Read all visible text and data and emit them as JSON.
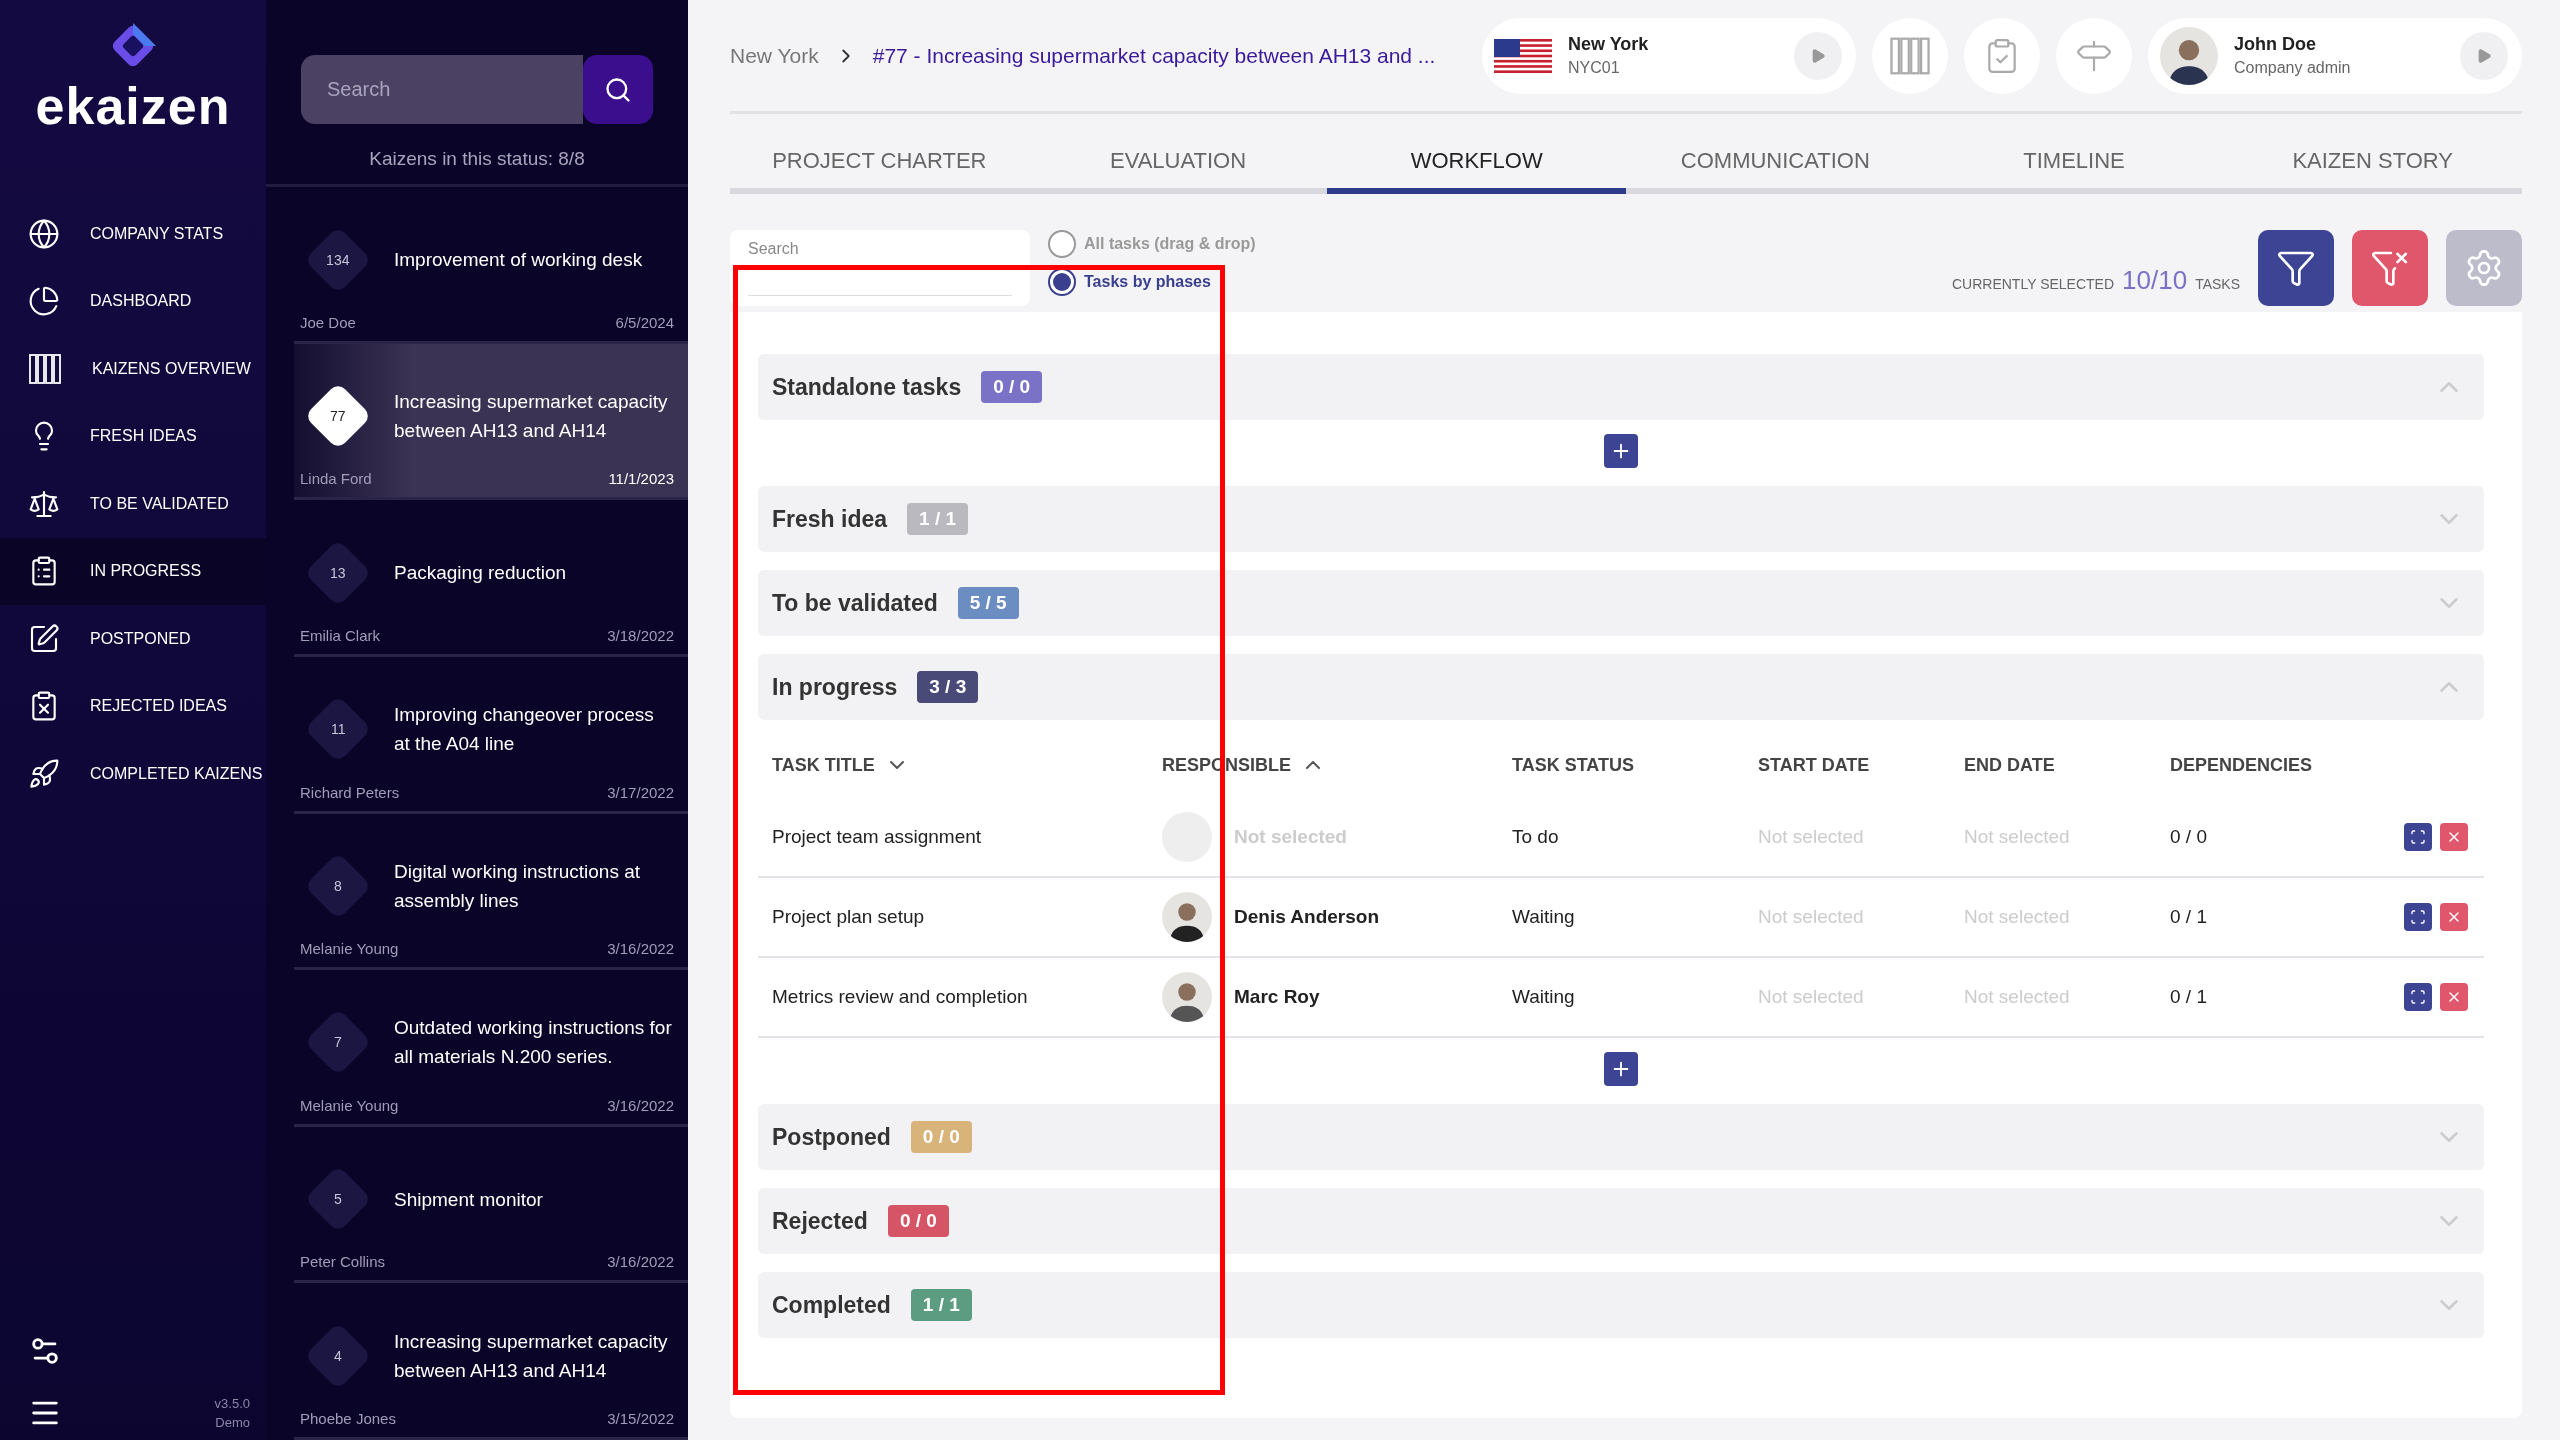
{
  "brand": "ekaizen",
  "nav": [
    {
      "label": "COMPANY STATS",
      "kind": "globe",
      "selected": false
    },
    {
      "label": "DASHBOARD",
      "kind": "pie",
      "selected": false
    },
    {
      "label": "KAIZENS OVERVIEW",
      "kind": "columns",
      "selected": false
    },
    {
      "label": "FRESH IDEAS",
      "kind": "bulb",
      "selected": false
    },
    {
      "label": "TO BE VALIDATED",
      "kind": "scale",
      "selected": false
    },
    {
      "label": "IN PROGRESS",
      "kind": "clipboard",
      "selected": true
    },
    {
      "label": "POSTPONED",
      "kind": "pen",
      "selected": false
    },
    {
      "label": "REJECTED IDEAS",
      "kind": "reject",
      "selected": false
    },
    {
      "label": "COMPLETED KAIZENS",
      "kind": "rocket",
      "selected": false
    }
  ],
  "version": "v3.5.0",
  "edition": "Demo",
  "list": {
    "search_placeholder": "Search",
    "count": "Kaizens in this status: 8/8",
    "kaizens": [
      {
        "number": "134",
        "title": "Improvement of working desk",
        "author": "Joe Doe",
        "date": "6/5/2024",
        "selected": false
      },
      {
        "number": "77",
        "title": "Increasing supermarket capacity between AH13 and AH14",
        "author": "Linda Ford",
        "date": "11/1/2023",
        "selected": true
      },
      {
        "number": "13",
        "title": "Packaging reduction",
        "author": "Emilia Clark",
        "date": "3/18/2022",
        "selected": false
      },
      {
        "number": "11",
        "title": "Improving changeover process at the A04 line",
        "author": "Richard Peters",
        "date": "3/17/2022",
        "selected": false
      },
      {
        "number": "8",
        "title": "Digital working instructions at assembly lines",
        "author": "Melanie Young",
        "date": "3/16/2022",
        "selected": false
      },
      {
        "number": "7",
        "title": "Outdated working instructions for all materials N.200 series.",
        "author": "Melanie Young",
        "date": "3/16/2022",
        "selected": false
      },
      {
        "number": "5",
        "title": "Shipment monitor",
        "author": "Peter Collins",
        "date": "3/16/2022",
        "selected": false
      },
      {
        "number": "4",
        "title": "Increasing supermarket capacity between AH13 and AH14",
        "author": "Phoebe Jones",
        "date": "3/15/2022",
        "selected": false
      }
    ]
  },
  "breadcrumb": [
    "New York",
    "#77 - Increasing supermarket capacity between AH13 and ..."
  ],
  "location": {
    "name": "New York",
    "code": "NYC01"
  },
  "user": {
    "name": "John Doe",
    "role": "Company admin"
  },
  "tabs": [
    {
      "label": "PROJECT CHARTER",
      "selected": false
    },
    {
      "label": "EVALUATION",
      "selected": false
    },
    {
      "label": "WORKFLOW",
      "selected": true
    },
    {
      "label": "COMMUNICATION",
      "selected": false
    },
    {
      "label": "TIMELINE",
      "selected": false
    },
    {
      "label": "KAIZEN STORY",
      "selected": false
    }
  ],
  "toolbar": {
    "search_label": "Search",
    "view_options": [
      {
        "label": "All tasks (drag & drop)",
        "selected": false
      },
      {
        "label": "Tasks by phases",
        "selected": true
      }
    ],
    "selected_label": "CURRENTLY SELECTED",
    "selected_count": "10/10",
    "selected_unit": "TASKS"
  },
  "columns": [
    {
      "label": "TASK TITLE",
      "sorted": true,
      "ascending": false
    },
    {
      "label": "RESPONSIBLE",
      "sorted": true,
      "ascending": true
    },
    {
      "label": "TASK STATUS",
      "sorted": false
    },
    {
      "label": "START DATE",
      "sorted": false
    },
    {
      "label": "END DATE",
      "sorted": false
    },
    {
      "label": "DEPENDENCIES",
      "sorted": false
    }
  ],
  "phases": [
    {
      "name": "Standalone tasks",
      "count": "0 / 0",
      "color": "#7a72c6",
      "expanded": true
    },
    {
      "name": "Fresh idea",
      "count": "1 / 1",
      "color": "#b9b9bf",
      "expanded": false
    },
    {
      "name": "To be validated",
      "count": "5 / 5",
      "color": "#6c8dc2",
      "expanded": false
    },
    {
      "name": "In progress",
      "count": "3 / 3",
      "color": "#4a4a78",
      "expanded": true,
      "tasks": [
        {
          "title": "Project team assignment",
          "responsible": "Not selected",
          "assigned": false,
          "status": "To do",
          "start": "Not selected",
          "end": "Not selected",
          "dependencies": "0 / 0"
        },
        {
          "title": "Project plan setup",
          "responsible": "Denis Anderson",
          "assigned": true,
          "status": "Waiting",
          "start": "Not selected",
          "end": "Not selected",
          "dependencies": "0 / 1"
        },
        {
          "title": "Metrics review and completion",
          "responsible": "Marc Roy",
          "assigned": true,
          "status": "Waiting",
          "start": "Not selected",
          "end": "Not selected",
          "dependencies": "0 / 1"
        }
      ]
    },
    {
      "name": "Postponed",
      "count": "0 / 0",
      "color": "#d9b47a",
      "expanded": false
    },
    {
      "name": "Rejected",
      "count": "0 / 0",
      "color": "#d55566",
      "expanded": false
    },
    {
      "name": "Completed",
      "count": "1 / 1",
      "color": "#5c9c80",
      "expanded": false
    }
  ]
}
